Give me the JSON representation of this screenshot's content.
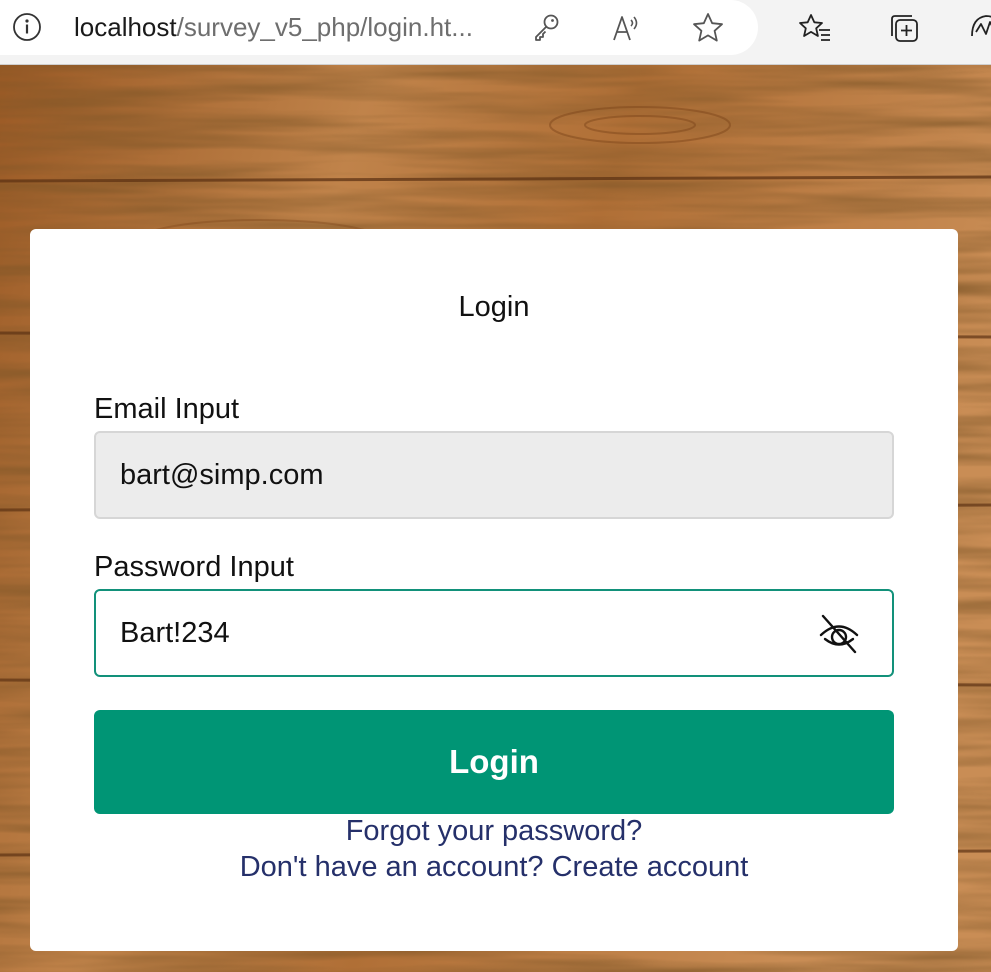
{
  "browser": {
    "url_host": "localhost",
    "url_path": "/survey_v5_php/login.ht...",
    "icons": [
      "info-icon",
      "key-icon",
      "read-aloud-icon",
      "favorite-star-icon",
      "favorites-list-icon",
      "collections-icon",
      "performance-icon"
    ]
  },
  "login_form": {
    "title": "Login",
    "email": {
      "label": "Email Input",
      "value": "bart@simp.com"
    },
    "password": {
      "label": "Password Input",
      "value": "Bart!234",
      "toggle_icon": "eye-slash-icon"
    },
    "submit_label": "Login",
    "forgot_password": "Forgot your password?",
    "signup_prompt": "Don't have an account?",
    "signup_link": "Create account"
  },
  "colors": {
    "primary": "#009575",
    "link": "#25306a",
    "wood_background": "#a6652c"
  }
}
